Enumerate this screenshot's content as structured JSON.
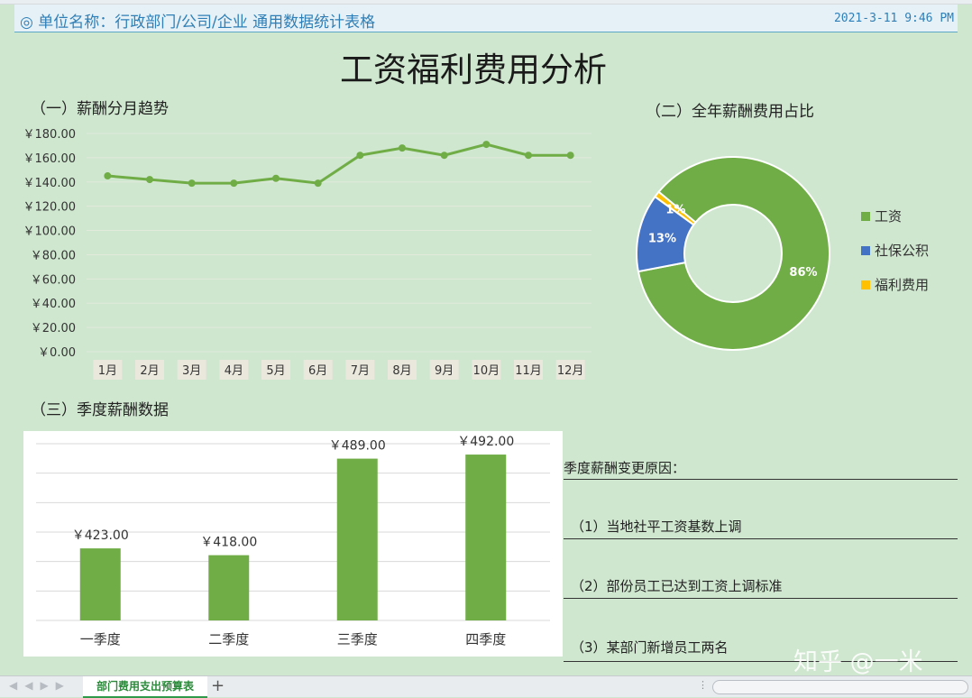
{
  "header": {
    "unit_label": "◎ 单位名称：行政部门/公司/企业 通用数据统计表格",
    "datetime": "2021-3-11  9:46 PM"
  },
  "title": "工资福利费用分析",
  "sections": {
    "monthly": "（一）薪酬分月趋势",
    "share": "（二）全年薪酬费用占比",
    "quarterly": "（三）季度薪酬数据"
  },
  "reasons": {
    "heading": "季度薪酬变更原因：",
    "items": [
      "（1）当地社平工资基数上调",
      "（2）部份员工已达到工资上调标准",
      "（3）某部门新增员工两名"
    ]
  },
  "watermark": "知乎 @一米",
  "sheet_tab": "部门费用支出预算表",
  "add_tab": "+",
  "colors": {
    "green": "#70ad47",
    "blue": "#4472c4",
    "yellow": "#ffc000",
    "background": "#cfe6cf"
  },
  "chart_data": [
    {
      "type": "line",
      "title": "（一）薪酬分月趋势",
      "categories": [
        "1月",
        "2月",
        "3月",
        "4月",
        "5月",
        "6月",
        "7月",
        "8月",
        "9月",
        "10月",
        "11月",
        "12月"
      ],
      "values": [
        145,
        142,
        139,
        139,
        143,
        139,
        162,
        168,
        162,
        171,
        162,
        162
      ],
      "ylim": [
        0,
        180
      ],
      "yticks": [
        "￥0.00",
        "￥20.00",
        "￥40.00",
        "￥60.00",
        "￥80.00",
        "￥100.00",
        "￥120.00",
        "￥140.00",
        "￥160.00",
        "￥180.00"
      ],
      "grid": true
    },
    {
      "type": "pie",
      "title": "（二）全年薪酬费用占比",
      "categories": [
        "工资",
        "社保公积",
        "福利费用"
      ],
      "values": [
        86,
        13,
        1
      ],
      "labels": [
        "86%",
        "13%",
        "1%"
      ],
      "legend": "right"
    },
    {
      "type": "bar",
      "title": "（三）季度薪酬数据",
      "categories": [
        "一季度",
        "二季度",
        "三季度",
        "四季度"
      ],
      "values": [
        423,
        418,
        489,
        492
      ],
      "data_labels": [
        "￥423.00",
        "￥418.00",
        "￥489.00",
        "￥492.00"
      ],
      "ylim": [
        370,
        500
      ],
      "grid": true
    }
  ]
}
